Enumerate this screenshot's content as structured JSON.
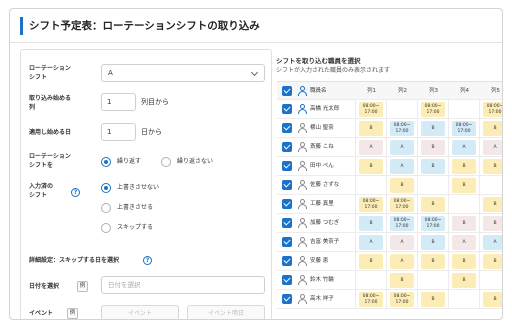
{
  "page_title": "シフト予定表：ローテーションシフトの取り込み",
  "form": {
    "rotation_shift": {
      "label_line1": "ローテーション",
      "label_line2": "シフト",
      "value": "A"
    },
    "start_column": {
      "label_line1": "取り込み始める",
      "label_line2": "列",
      "value": "1",
      "suffix": "列目から"
    },
    "apply_start_day": {
      "label": "適用し始める日",
      "value": "1",
      "suffix": "日から"
    },
    "repeat_rotation": {
      "label_line1": "ローテーション",
      "label_line2": "シフトを",
      "options": [
        {
          "label": "繰り返す",
          "selected": true
        },
        {
          "label": "繰り返さない",
          "selected": false
        }
      ]
    },
    "entered_shift": {
      "label_line1": "入力済の",
      "label_line2": "シフト",
      "options": [
        {
          "label": "上書きさせない",
          "selected": true
        },
        {
          "label": "上書きさせる",
          "selected": false
        },
        {
          "label": "スキップする",
          "selected": false
        }
      ]
    },
    "advanced": {
      "label": "詳細設定：スキップする日を選択"
    },
    "date_select": {
      "label": "日付を選択",
      "tag": "例",
      "placeholder": "日付を選択"
    },
    "event": {
      "label": "イベント",
      "tag": "例",
      "select_label": "イベント",
      "button_label": "イベント明日"
    }
  },
  "staff_table": {
    "heading": "シフトを取り込む職員を選択",
    "subheading": "シフトが入力された職員のみ表示されます",
    "name_header": "職員名",
    "column_headers": [
      "列1",
      "列2",
      "列3",
      "列4",
      "列5"
    ],
    "colors": {
      "blue": "#d3eaf7",
      "yellow": "#fbedb5",
      "pink": "#f4e7e7",
      "check": "#1a73c8"
    },
    "rows": [
      {
        "name": "高橋 光太郎",
        "self": true,
        "cells": [
          {
            "t": "08:00~17:00",
            "c": "yellow"
          },
          {
            "t": "",
            "c": ""
          },
          {
            "t": "08:00~17:00",
            "c": "yellow"
          },
          {
            "t": "",
            "c": ""
          },
          {
            "t": "08:00~17:00",
            "c": "yellow"
          }
        ]
      },
      {
        "name": "横山 聖奈",
        "self": false,
        "cells": [
          {
            "t": "B",
            "c": "yellow"
          },
          {
            "t": "08:00~17:00",
            "c": "blue"
          },
          {
            "t": "B",
            "c": "blue"
          },
          {
            "t": "08:00~17:00",
            "c": "blue"
          },
          {
            "t": "B",
            "c": "yellow"
          }
        ]
      },
      {
        "name": "斎藤 こね",
        "self": false,
        "cells": [
          {
            "t": "A",
            "c": "pink"
          },
          {
            "t": "A",
            "c": "blue"
          },
          {
            "t": "B",
            "c": "pink"
          },
          {
            "t": "A",
            "c": "blue"
          },
          {
            "t": "A",
            "c": "pink"
          }
        ]
      },
      {
        "name": "田中 ぺん",
        "self": false,
        "cells": [
          {
            "t": "B",
            "c": "yellow"
          },
          {
            "t": "A",
            "c": "blue"
          },
          {
            "t": "B",
            "c": "blue"
          },
          {
            "t": "B",
            "c": "yellow"
          },
          {
            "t": "B",
            "c": "yellow"
          }
        ]
      },
      {
        "name": "佐藤 さずな",
        "self": false,
        "cells": [
          {
            "t": "",
            "c": ""
          },
          {
            "t": "B",
            "c": "yellow"
          },
          {
            "t": "",
            "c": ""
          },
          {
            "t": "B",
            "c": "yellow"
          },
          {
            "t": "",
            "c": ""
          }
        ]
      },
      {
        "name": "工藤 真里",
        "self": false,
        "cells": [
          {
            "t": "08:00~17:00",
            "c": "yellow"
          },
          {
            "t": "08:00~17:00",
            "c": "yellow"
          },
          {
            "t": "B",
            "c": "yellow"
          },
          {
            "t": "",
            "c": ""
          },
          {
            "t": "B",
            "c": "yellow"
          }
        ]
      },
      {
        "name": "加藤 つむぎ",
        "self": false,
        "cells": [
          {
            "t": "B",
            "c": "blue"
          },
          {
            "t": "08:00~17:00",
            "c": "blue"
          },
          {
            "t": "08:00~17:00",
            "c": "blue"
          },
          {
            "t": "B",
            "c": "pink"
          },
          {
            "t": "B",
            "c": "pink"
          }
        ]
      },
      {
        "name": "吉富 美奈子",
        "self": false,
        "cells": [
          {
            "t": "A",
            "c": "blue"
          },
          {
            "t": "A",
            "c": "pink"
          },
          {
            "t": "B",
            "c": "blue"
          },
          {
            "t": "A",
            "c": "pink"
          },
          {
            "t": "A",
            "c": "blue"
          }
        ]
      },
      {
        "name": "安藤 恵",
        "self": false,
        "cells": [
          {
            "t": "B",
            "c": "yellow"
          },
          {
            "t": "A",
            "c": "yellow"
          },
          {
            "t": "B",
            "c": "yellow"
          },
          {
            "t": "B",
            "c": "yellow"
          },
          {
            "t": "B",
            "c": "yellow"
          }
        ]
      },
      {
        "name": "鈴木 竹輪",
        "self": false,
        "cells": [
          {
            "t": "",
            "c": ""
          },
          {
            "t": "B",
            "c": "yellow"
          },
          {
            "t": "",
            "c": ""
          },
          {
            "t": "B",
            "c": "yellow"
          },
          {
            "t": "",
            "c": ""
          }
        ]
      },
      {
        "name": "高木 祥子",
        "self": false,
        "cells": [
          {
            "t": "08:00~17:00",
            "c": "yellow"
          },
          {
            "t": "08:00~17:00",
            "c": "yellow"
          },
          {
            "t": "B",
            "c": "yellow"
          },
          {
            "t": "",
            "c": ""
          },
          {
            "t": "B",
            "c": "yellow"
          }
        ]
      }
    ]
  }
}
